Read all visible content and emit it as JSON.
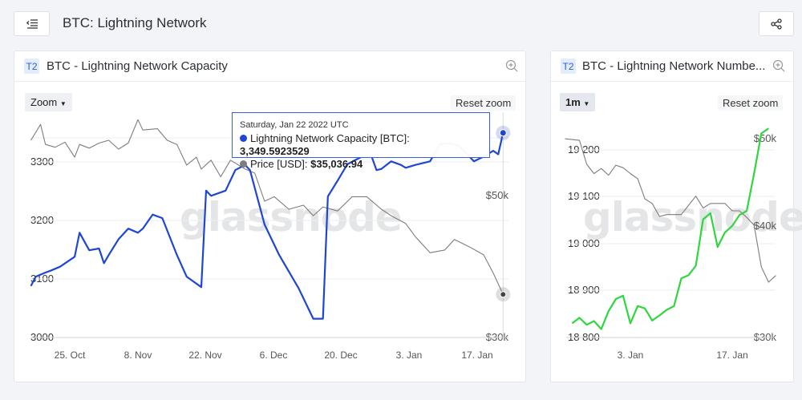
{
  "header": {
    "title": "BTC: Lightning Network",
    "menu_icon": "collapse-menu-icon",
    "share_icon": "share-icon"
  },
  "colors": {
    "capacity": "#1f46d3",
    "nodes": "#2fd63f",
    "price": "#7d7d7d",
    "accent": "#2d5fd3"
  },
  "left_card": {
    "badge": "T2",
    "title": "BTC - Lightning Network Capacity",
    "zoom_label": "Zoom",
    "reset_label": "Reset zoom",
    "watermark": "glassnode",
    "tooltip": {
      "date": "Saturday, Jan 22 2022 UTC",
      "line1_label": "Lightning Network Capacity [BTC]: ",
      "line1_value": "3,349.5923529",
      "line2_label": "Price [USD]: ",
      "line2_value": "$35,036.94"
    }
  },
  "right_card": {
    "badge": "T2",
    "title": "BTC - Lightning Network Numbe...",
    "zoom_label": "1m",
    "reset_label": "Reset zoom",
    "watermark": "glassnode"
  },
  "chart_data": [
    {
      "type": "line",
      "title": "BTC - Lightning Network Capacity",
      "y_ticks": [
        "3000",
        "3100",
        "3200",
        "3300"
      ],
      "ylim": [
        3000,
        3350
      ],
      "y2_ticks": [
        "$30k",
        "$50k"
      ],
      "y2_scale": "log",
      "x_ticks": [
        "25. Oct",
        "8. Nov",
        "22. Nov",
        "6. Dec",
        "20. Dec",
        "3. Jan",
        "17. Jan"
      ],
      "grid": true,
      "legend": "none",
      "series": [
        {
          "name": "Lightning Network Capacity [BTC]",
          "axis": "left",
          "color": "#1f46d3",
          "x": [
            "2021-10-17",
            "2021-10-18",
            "2021-10-20",
            "2021-10-21",
            "2021-10-23",
            "2021-10-26",
            "2021-10-27",
            "2021-10-29",
            "2021-10-31",
            "2021-11-01",
            "2021-11-02",
            "2021-11-04",
            "2021-11-06",
            "2021-11-08",
            "2021-11-09",
            "2021-11-11",
            "2021-11-13",
            "2021-11-16",
            "2021-11-18",
            "2021-11-21",
            "2021-11-22",
            "2021-11-23",
            "2021-11-26",
            "2021-11-28",
            "2021-11-30",
            "2021-12-01",
            "2021-12-04",
            "2021-12-07",
            "2021-12-11",
            "2021-12-14",
            "2021-12-16",
            "2021-12-17",
            "2021-12-19",
            "2021-12-21",
            "2021-12-24",
            "2021-12-26",
            "2021-12-27",
            "2021-12-28",
            "2021-12-30",
            "2022-01-01",
            "2022-01-02",
            "2022-01-04",
            "2022-01-07",
            "2022-01-09",
            "2022-01-11",
            "2022-01-13",
            "2022-01-16",
            "2022-01-18",
            "2022-01-20",
            "2022-01-21",
            "2022-01-22"
          ],
          "y": [
            3088,
            3104,
            3111,
            3114,
            3121,
            3138,
            3179,
            3149,
            3152,
            3127,
            3141,
            3168,
            3186,
            3179,
            3186,
            3210,
            3204,
            3141,
            3104,
            3086,
            3251,
            3242,
            3251,
            3286,
            3295,
            3286,
            3193,
            3141,
            3084,
            3032,
            3032,
            3241,
            3268,
            3296,
            3309,
            3309,
            3286,
            3288,
            3301,
            3295,
            3290,
            3295,
            3301,
            3330,
            3332,
            3327,
            3301,
            3309,
            3319,
            3313,
            3349.59
          ]
        },
        {
          "name": "Price [USD]",
          "axis": "right",
          "color": "#7d7d7d",
          "x": [
            "2021-10-17",
            "2021-10-19",
            "2021-10-20",
            "2021-10-22",
            "2021-10-24",
            "2021-10-26",
            "2021-10-27",
            "2021-10-29",
            "2021-10-31",
            "2021-11-02",
            "2021-11-04",
            "2021-11-06",
            "2021-11-08",
            "2021-11-09",
            "2021-11-12",
            "2021-11-14",
            "2021-11-16",
            "2021-11-18",
            "2021-11-20",
            "2021-11-21",
            "2021-11-23",
            "2021-11-25",
            "2021-11-27",
            "2021-11-30",
            "2021-12-02",
            "2021-12-04",
            "2021-12-06",
            "2021-12-09",
            "2021-12-12",
            "2021-12-14",
            "2021-12-16",
            "2021-12-19",
            "2021-12-22",
            "2021-12-25",
            "2021-12-28",
            "2021-12-30",
            "2022-01-02",
            "2022-01-04",
            "2022-01-07",
            "2022-01-10",
            "2022-01-12",
            "2022-01-15",
            "2022-01-18",
            "2022-01-20",
            "2022-01-22"
          ],
          "y": [
            61000,
            64600,
            60100,
            59500,
            60600,
            57400,
            60100,
            59300,
            60400,
            61000,
            59100,
            60400,
            65700,
            63300,
            63600,
            61000,
            60100,
            55800,
            57400,
            55000,
            56800,
            53500,
            56800,
            55000,
            54200,
            49000,
            49800,
            47600,
            48300,
            46500,
            48000,
            47300,
            49800,
            49800,
            47600,
            46500,
            45200,
            43100,
            40700,
            41100,
            42700,
            41600,
            40400,
            37800,
            35036.94
          ]
        }
      ]
    },
    {
      "type": "line",
      "title": "BTC - Lightning Network Numbe...",
      "y_ticks": [
        "18 800",
        "18 900",
        "19 000",
        "19 100",
        "19 200"
      ],
      "ylim": [
        18800,
        19250
      ],
      "y2_ticks": [
        "$30k",
        "$40k",
        "$50k"
      ],
      "y2_scale": "log",
      "x_ticks": [
        "3. Jan",
        "17. Jan"
      ],
      "grid": true,
      "legend": "none",
      "series": [
        {
          "axis": "left",
          "color": "#2fd63f",
          "x": [
            "2021-12-26",
            "2021-12-27",
            "2021-12-28",
            "2021-12-29",
            "2021-12-30",
            "2021-12-31",
            "2022-01-01",
            "2022-01-02",
            "2022-01-03",
            "2022-01-04",
            "2022-01-05",
            "2022-01-06",
            "2022-01-07",
            "2022-01-08",
            "2022-01-09",
            "2022-01-10",
            "2022-01-11",
            "2022-01-12",
            "2022-01-13",
            "2022-01-14",
            "2022-01-15",
            "2022-01-16",
            "2022-01-17",
            "2022-01-18",
            "2022-01-19",
            "2022-01-20",
            "2022-01-21",
            "2022-01-22"
          ],
          "y": [
            18830,
            18842,
            18827,
            18835,
            18818,
            18856,
            18882,
            18889,
            18830,
            18867,
            18862,
            18836,
            18847,
            18859,
            18867,
            18926,
            18933,
            18953,
            19052,
            19065,
            18993,
            19024,
            19038,
            19061,
            19070,
            19149,
            19235,
            19246
          ]
        },
        {
          "axis": "right",
          "color": "#7d7d7d",
          "x": [
            "2021-12-25",
            "2021-12-27",
            "2021-12-28",
            "2021-12-29",
            "2021-12-30",
            "2021-12-31",
            "2022-01-01",
            "2022-01-02",
            "2022-01-03",
            "2022-01-04",
            "2022-01-05",
            "2022-01-06",
            "2022-01-07",
            "2022-01-08",
            "2022-01-10",
            "2022-01-12",
            "2022-01-13",
            "2022-01-14",
            "2022-01-16",
            "2022-01-17",
            "2022-01-18",
            "2022-01-19",
            "2022-01-20",
            "2022-01-21",
            "2022-01-22",
            "2022-01-23"
          ],
          "y": [
            50100,
            49900,
            46900,
            45800,
            46400,
            45600,
            46800,
            46500,
            45800,
            45200,
            42900,
            42400,
            41000,
            41200,
            41200,
            43200,
            41900,
            42400,
            42400,
            41600,
            41600,
            40900,
            40100,
            36000,
            34600,
            35200
          ]
        }
      ]
    }
  ]
}
